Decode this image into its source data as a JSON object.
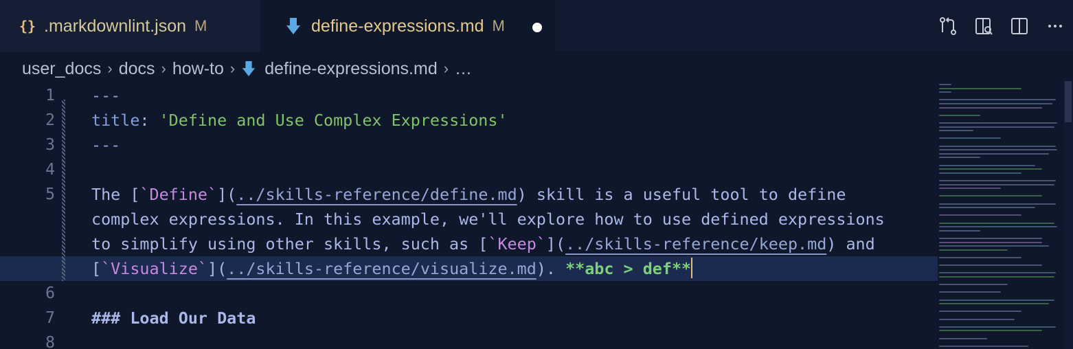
{
  "tabs": [
    {
      "icon": "{}",
      "title": ".markdownlint.json",
      "status": "M"
    },
    {
      "icon": "markdown-arrow-icon",
      "title": "define-expressions.md",
      "status": "M",
      "dirty": true
    }
  ],
  "breadcrumb": [
    "user_docs",
    "docs",
    "how-to",
    "define-expressions.md",
    "…"
  ],
  "editor": {
    "line_numbers": [
      "1",
      "2",
      "3",
      "4",
      "5",
      "",
      "",
      "",
      "6",
      "7",
      "8"
    ],
    "line1": "---",
    "line2_key": "title",
    "line2_colon": ": ",
    "line2_value": "'Define and Use Complex Expressions'",
    "line3": "---",
    "para": {
      "r1_a": "The [",
      "r1_b": "`Define`",
      "r1_c": "](",
      "r1_d": "../skills-reference/define.md",
      "r1_e": ") skill is a useful tool to define",
      "r2": "complex expressions. In this example, we'll explore how to use defined expressions",
      "r3_a": "to simplify using other skills, such as [",
      "r3_b": "`Keep`",
      "r3_c": "](",
      "r3_d": "../skills-reference/keep.md",
      "r3_e": ") and",
      "r4_a": "[",
      "r4_b": "`Visualize`",
      "r4_c": "](",
      "r4_d": "../skills-reference/visualize.md",
      "r4_e": "). ",
      "r4_f": "**abc > def**"
    },
    "line7": "### Load Our Data"
  },
  "colors": {
    "background": "#0f172a",
    "accent_string": "#7fc36a",
    "accent_link": "#c58ae0",
    "tab_title": "#e6c98a"
  }
}
